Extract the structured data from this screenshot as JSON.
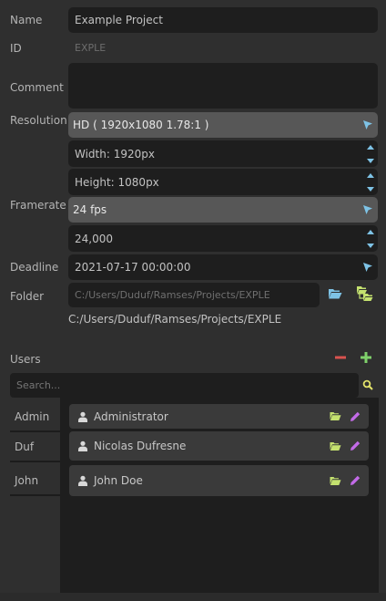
{
  "form": {
    "name_label": "Name",
    "name_value": "Example Project",
    "id_label": "ID",
    "id_value": "EXPLE",
    "comment_label": "Comment",
    "comment_value": "",
    "resolution_label": "Resolution",
    "resolution_preset": "HD ( 1920x1080 1.78:1 )",
    "width_value": "Width: 1920px",
    "height_value": "Height: 1080px",
    "framerate_label": "Framerate",
    "framerate_preset": "24 fps",
    "framerate_value": "24,000",
    "deadline_label": "Deadline",
    "deadline_value": "2021-07-17 00:00:00",
    "folder_label": "Folder",
    "folder_placeholder": "C:/Users/Duduf/Ramses/Projects/EXPLE",
    "folder_path": "C:/Users/Duduf/Ramses/Projects/EXPLE"
  },
  "users": {
    "label": "Users",
    "search_placeholder": "Search...",
    "tabs": [
      "Admin",
      "Duf",
      "John"
    ],
    "items": [
      {
        "name": "Administrator"
      },
      {
        "name": "Nicolas Dufresne"
      },
      {
        "name": "John Doe"
      }
    ]
  },
  "icons": {
    "cursor": "cursor-arrow-icon",
    "folder": "folder-open-icon",
    "folder_tree": "folder-tree-icon",
    "remove": "minus-icon",
    "add": "plus-icon",
    "search": "search-icon",
    "user": "user-icon",
    "edit": "pencil-icon"
  },
  "colors": {
    "accent_blue": "#7ec3e6",
    "remove_red": "#d9534f",
    "add_green": "#7fd16b",
    "folder_green": "#c4e16f",
    "edit_purple": "#c36be8",
    "search_yellow": "#e5e56b"
  }
}
